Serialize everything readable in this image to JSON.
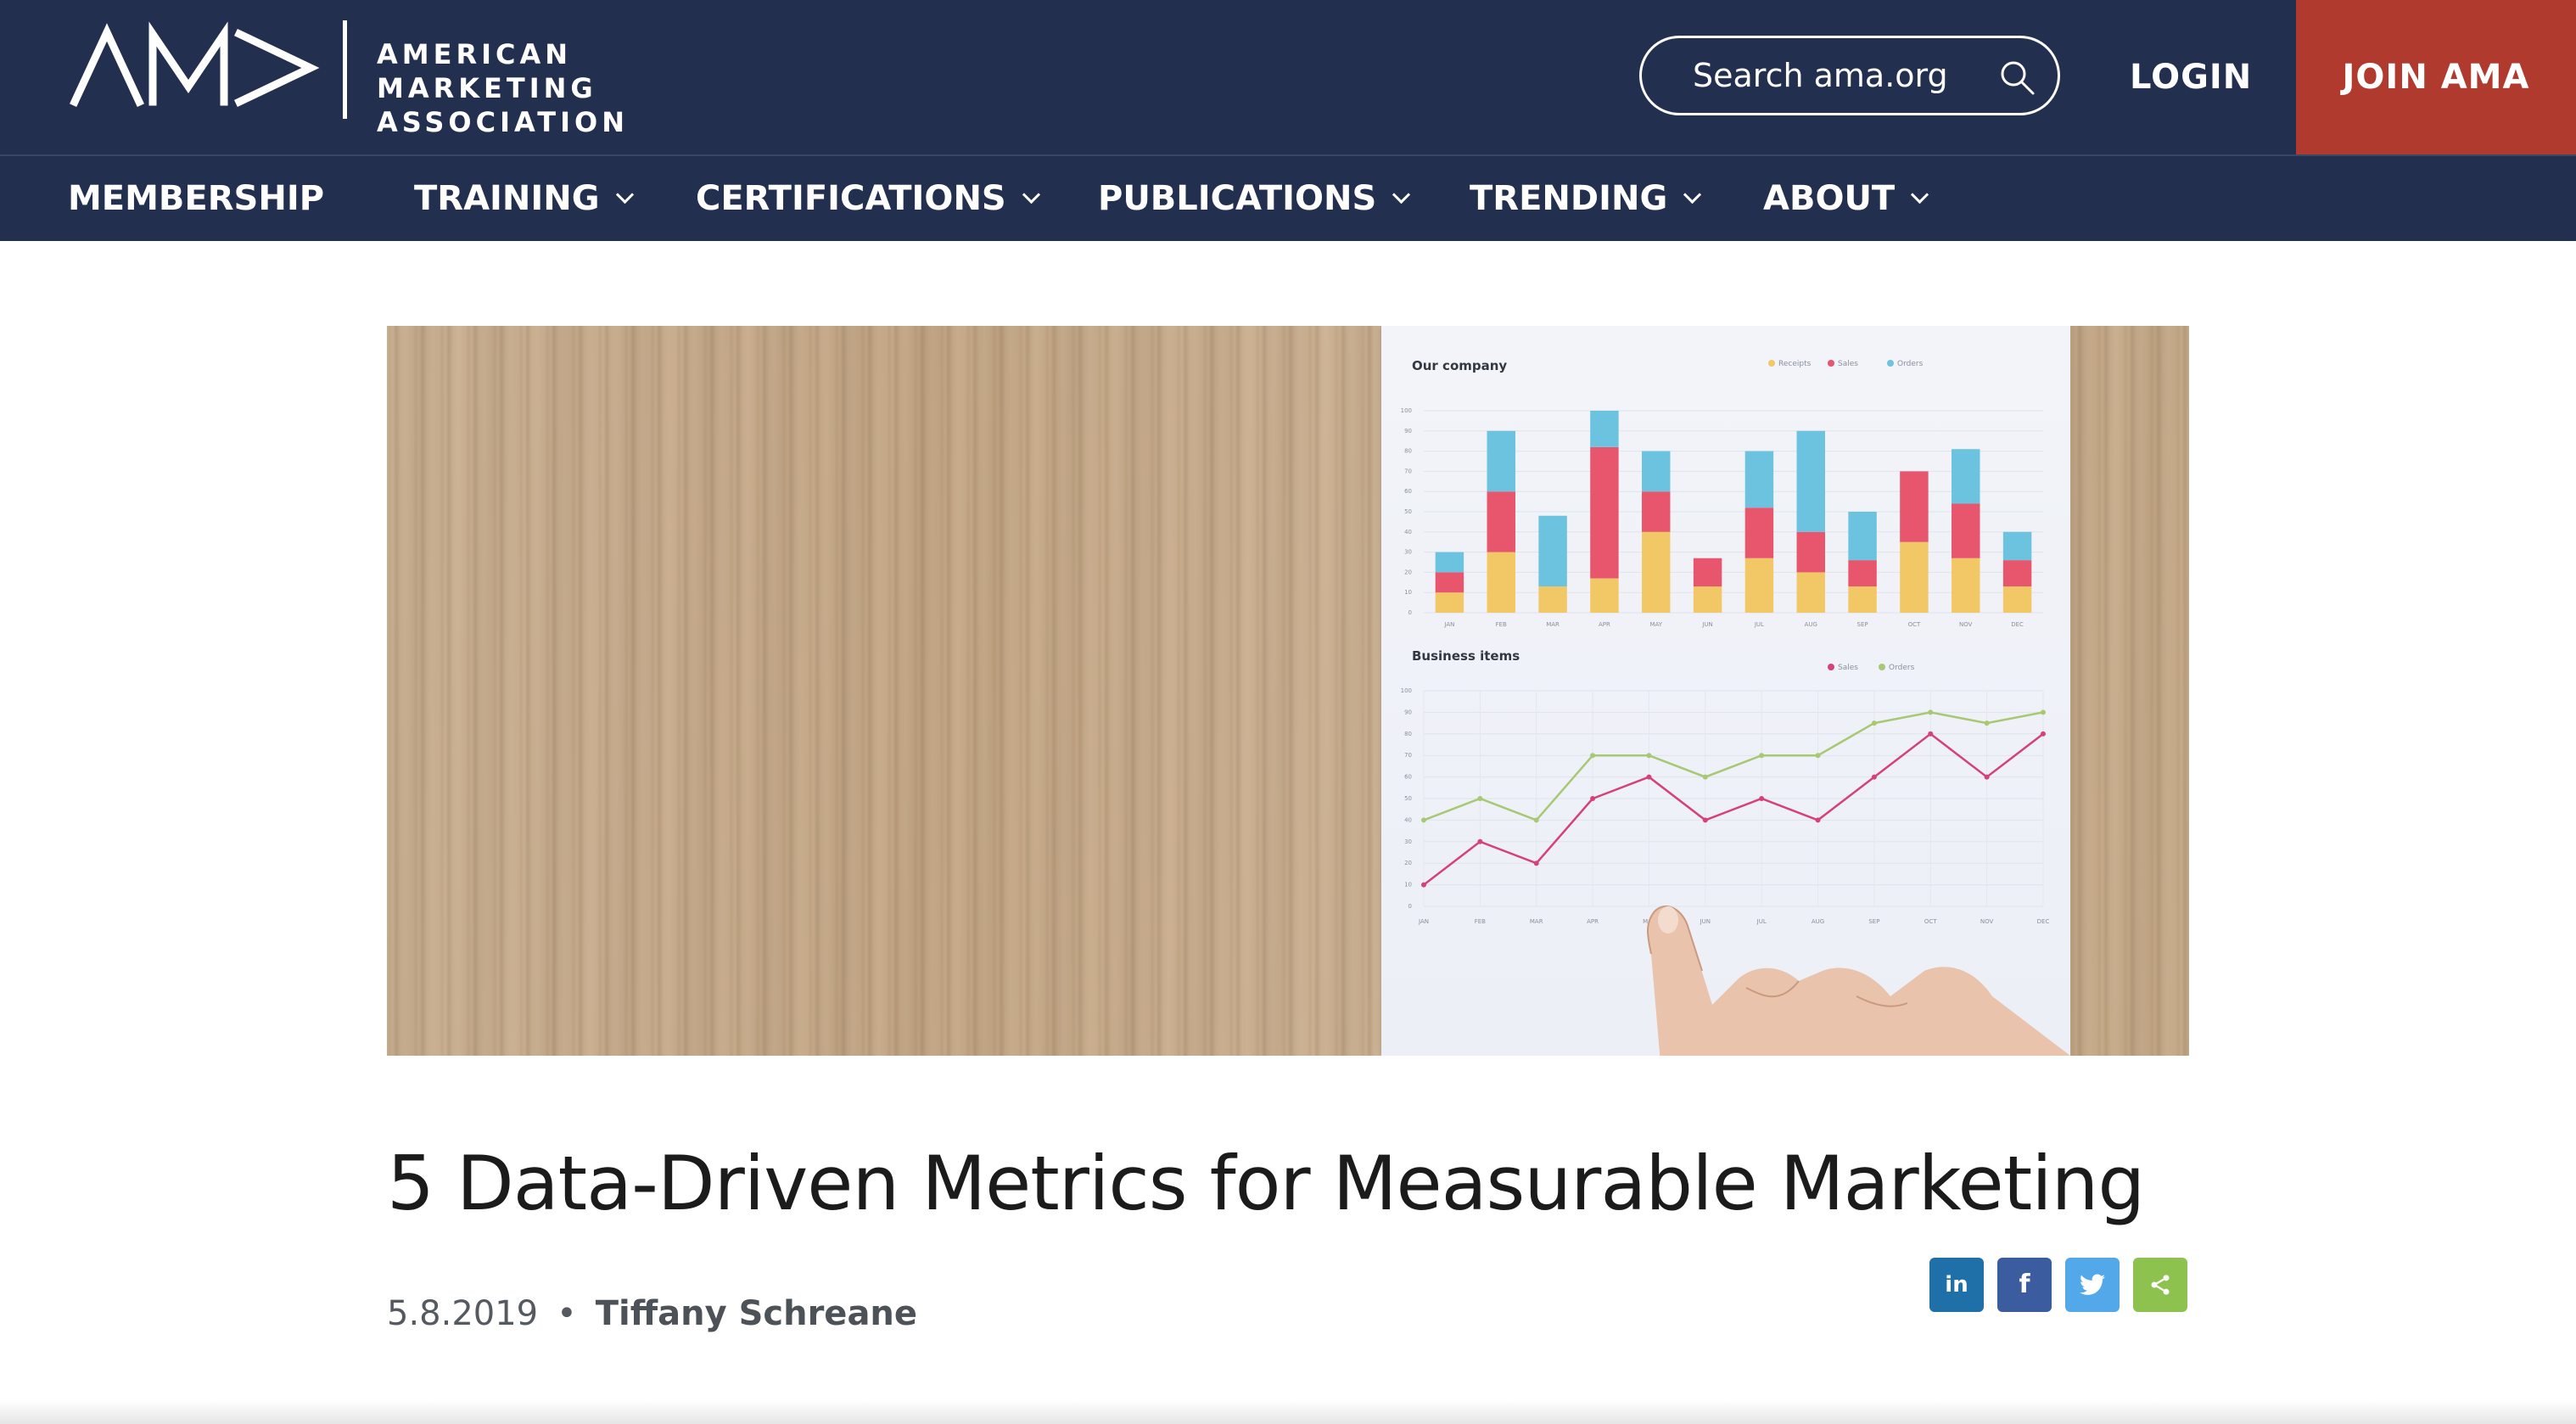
{
  "brand": {
    "logo_lines": [
      "AMERICAN MARKETING",
      "ASSOCIATION"
    ],
    "colors": {
      "navy": "#222f4e",
      "join_red": "#b13a2f"
    }
  },
  "header": {
    "search_placeholder": "Search ama.org",
    "login_label": "LOGIN",
    "join_label": "JOIN AMA"
  },
  "nav": {
    "items": [
      {
        "label": "MEMBERSHIP",
        "dropdown": false
      },
      {
        "label": "TRAINING",
        "dropdown": true
      },
      {
        "label": "CERTIFICATIONS",
        "dropdown": true
      },
      {
        "label": "PUBLICATIONS",
        "dropdown": true
      },
      {
        "label": "TRENDING",
        "dropdown": true
      },
      {
        "label": "ABOUT",
        "dropdown": true
      }
    ]
  },
  "hero": {
    "chart_data": [
      {
        "type": "bar",
        "title": "Our company",
        "categories": [
          "JAN",
          "FEB",
          "MAR",
          "APR",
          "MAY",
          "JUN",
          "JUL",
          "AUG",
          "SEP",
          "OCT",
          "NOV",
          "DEC"
        ],
        "series": [
          {
            "name": "Receipts",
            "color": "#f2c766",
            "values": [
              10,
              30,
              13,
              17,
              40,
              13,
              27,
              20,
              13,
              35,
              27,
              13
            ]
          },
          {
            "name": "Sales",
            "color": "#e8566e",
            "values": [
              10,
              30,
              0,
              65,
              20,
              14,
              25,
              20,
              13,
              35,
              27,
              13
            ]
          },
          {
            "name": "Orders",
            "color": "#6bc3e0",
            "values": [
              10,
              30,
              35,
              18,
              20,
              0,
              28,
              50,
              24,
              0,
              27,
              14
            ]
          }
        ],
        "ylim": [
          0,
          100
        ]
      },
      {
        "type": "line",
        "title": "Business items",
        "categories": [
          "JAN",
          "FEB",
          "MAR",
          "APR",
          "MAY",
          "JUN",
          "JUL",
          "AUG",
          "SEP",
          "OCT",
          "NOV",
          "DEC"
        ],
        "series": [
          {
            "name": "Sales",
            "color": "#d5427a",
            "values": [
              10,
              30,
              20,
              50,
              60,
              40,
              50,
              40,
              60,
              80,
              60,
              80
            ]
          },
          {
            "name": "Orders",
            "color": "#a8c873",
            "values": [
              40,
              50,
              40,
              70,
              70,
              60,
              70,
              70,
              85,
              90,
              85,
              90
            ]
          }
        ],
        "ylim": [
          0,
          100
        ]
      }
    ]
  },
  "article": {
    "title": "5 Data-Driven Metrics for Measurable Marketing",
    "date": "5.8.2019",
    "separator": "•",
    "author": "Tiffany Schreane"
  },
  "share": {
    "buttons": [
      {
        "label": "in",
        "icon": "linkedin-icon",
        "color": "#1f6fa8"
      },
      {
        "label": "f",
        "icon": "facebook-icon",
        "color": "#3b5c9f"
      },
      {
        "label": "",
        "icon": "twitter-icon",
        "color": "#52a8e8"
      },
      {
        "label": "",
        "icon": "share-icon",
        "color": "#8dc24f"
      }
    ]
  }
}
